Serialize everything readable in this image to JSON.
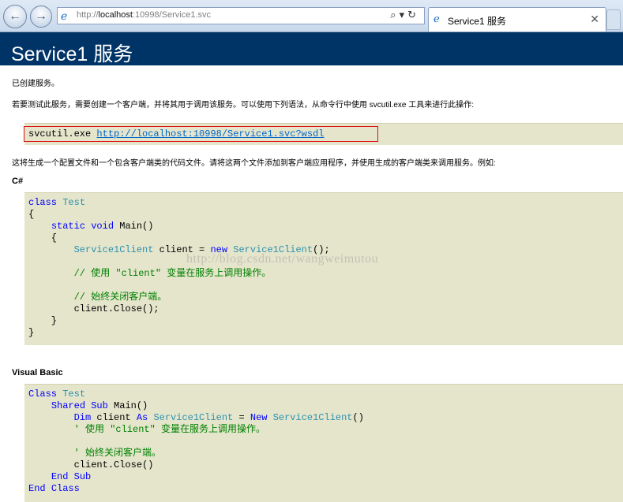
{
  "browser": {
    "address_prefix": "http://",
    "address_host": "localhost",
    "address_rest": ":10998/Service1.svc",
    "tab_title": "Service1 服务"
  },
  "page": {
    "title": "Service1 服务",
    "intro": "已创建服务。",
    "test_instructions": "若要测试此服务，需要创建一个客户端，并将其用于调用该服务。可以使用下列语法，从命令行中使用 svcutil.exe 工具来进行此操作:",
    "svcutil_cmd": "svcutil.exe",
    "svcutil_url": "http://localhost:10998/Service1.svc?wsdl",
    "generate_desc": "这将生成一个配置文件和一个包含客户端类的代码文件。请将这两个文件添加到客户端应用程序，并使用生成的客户端类来调用服务。例如:",
    "csharp_heading": "C#",
    "vb_heading": "Visual Basic",
    "watermark": "http://blog.csdn.net/wangweimutou"
  }
}
